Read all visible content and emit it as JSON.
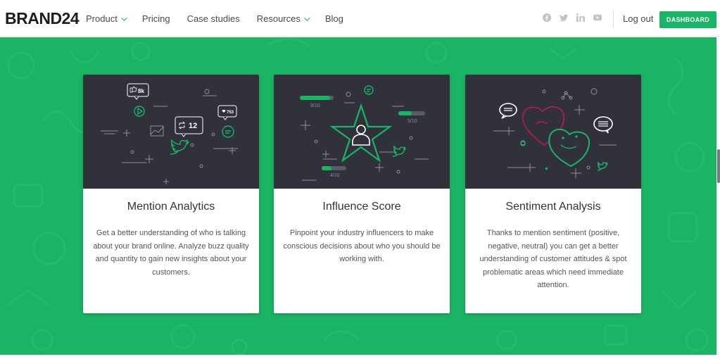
{
  "nav": {
    "logo": "BRAND24",
    "items": [
      {
        "label": "Product",
        "has_dropdown": true
      },
      {
        "label": "Pricing",
        "has_dropdown": false
      },
      {
        "label": "Case studies",
        "has_dropdown": false
      },
      {
        "label": "Resources",
        "has_dropdown": true
      },
      {
        "label": "Blog",
        "has_dropdown": false
      }
    ],
    "social_icons": [
      "facebook-icon",
      "twitter-icon",
      "linkedin-icon",
      "youtube-icon"
    ],
    "logout": "Log out",
    "dashboard": "DASHBOARD"
  },
  "colors": {
    "brand_green": "#18b566",
    "hero_green": "#1bb464",
    "card_dark": "#30313a",
    "accent_pink": "#c2185b"
  },
  "cards": [
    {
      "title": "Mention Analytics",
      "text": "Get a better understanding of who is talking about your brand online. Analyze buzz quality and quantity to gain new insights about your customers.",
      "illustration": {
        "likes": "8k",
        "retweets": "12",
        "hearts": "753"
      }
    },
    {
      "title": "Influence Score",
      "text": "Pinpoint your industry influencers to make conscious decisions about who you should be working with.",
      "illustration": {
        "score_a": "9/10",
        "score_b": "5/10",
        "score_c": "4/10"
      }
    },
    {
      "title": "Sentiment Analysis",
      "text": "Thanks to mention sentiment (positive, negative, neutral) you can get a better understanding of customer attitudes & spot problematic areas which need immediate attention.",
      "illustration": {}
    }
  ]
}
